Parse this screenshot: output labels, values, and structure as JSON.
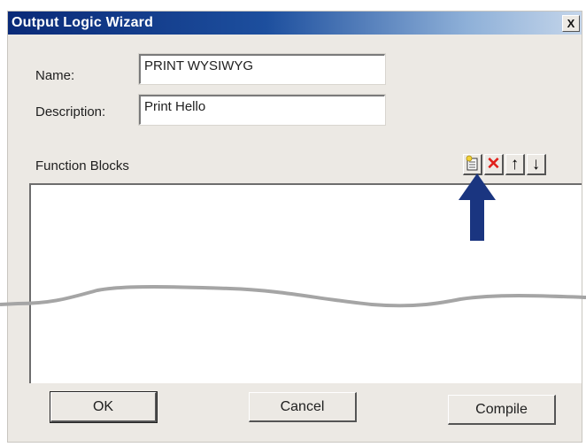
{
  "window": {
    "title": "Output Logic Wizard",
    "close_label": "X"
  },
  "form": {
    "name_label": "Name:",
    "name_value": "PRINT WYSIWYG",
    "description_label": "Description:",
    "description_value": "Print Hello"
  },
  "function_blocks": {
    "label": "Function Blocks",
    "toolbar": [
      {
        "name": "add-block-icon",
        "glyph": ""
      },
      {
        "name": "delete-block-icon",
        "glyph": "✕"
      },
      {
        "name": "move-up-icon",
        "glyph": "↑"
      },
      {
        "name": "move-down-icon",
        "glyph": "↓"
      }
    ]
  },
  "buttons": {
    "ok": "OK",
    "cancel": "Cancel",
    "compile": "Compile"
  },
  "colors": {
    "title_bar": "#0a2a78",
    "pointer_arrow": "#1a3580",
    "delete_icon": "#e0201b"
  }
}
